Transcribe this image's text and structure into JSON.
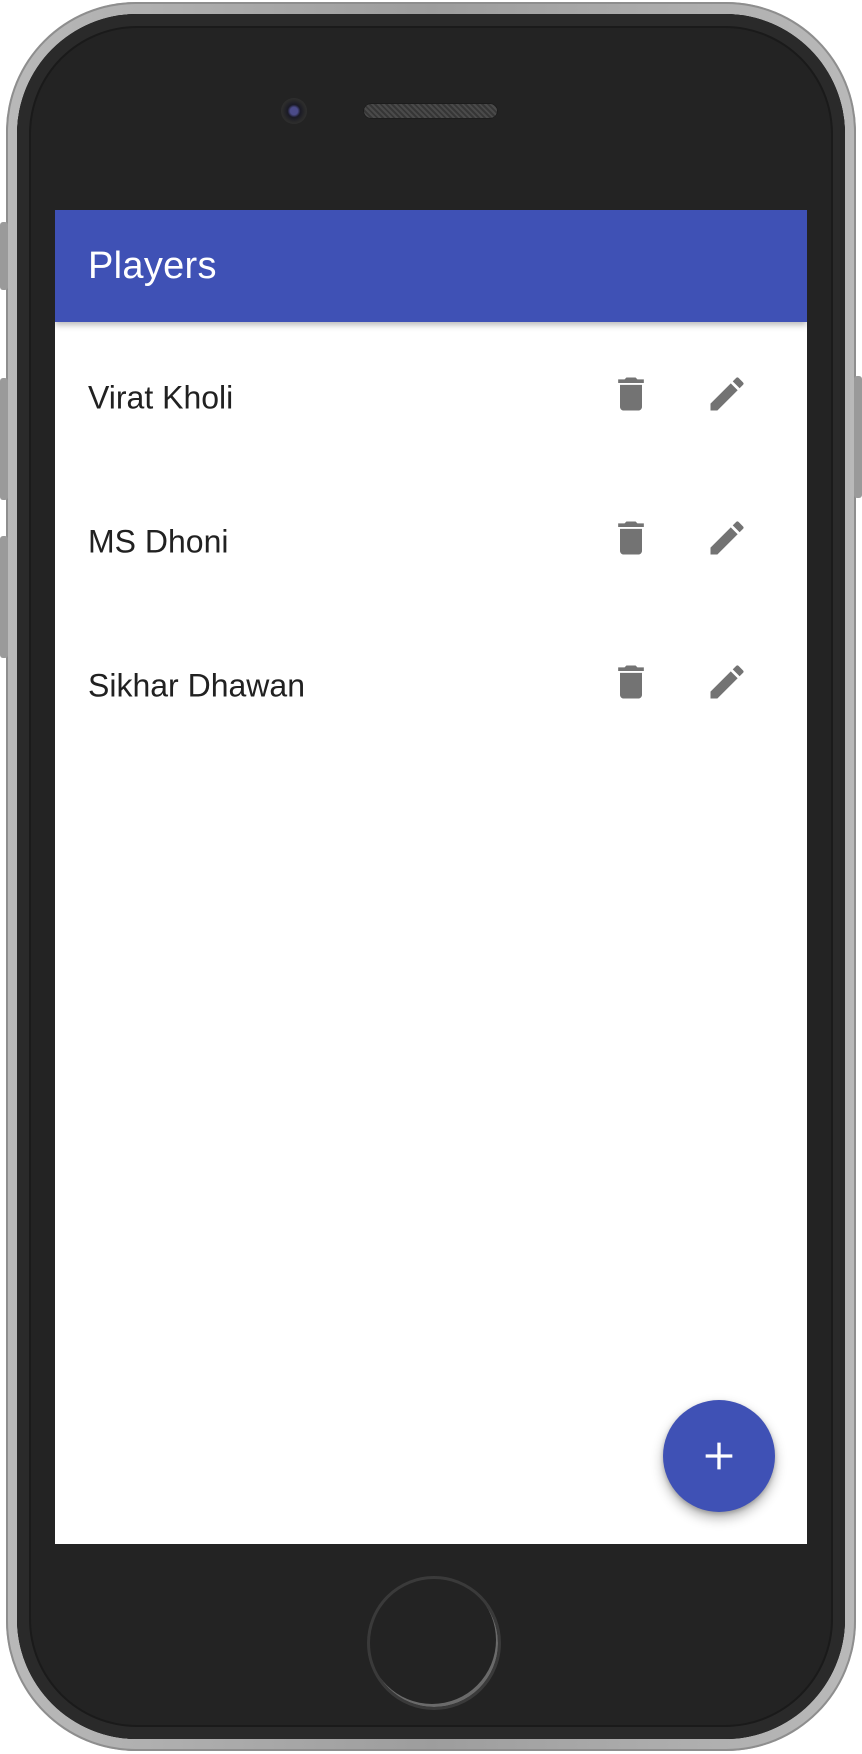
{
  "app": {
    "title": "Players"
  },
  "players": [
    {
      "name": "Virat Kholi"
    },
    {
      "name": "MS Dhoni"
    },
    {
      "name": "Sikhar Dhawan"
    }
  ],
  "icons": {
    "delete": "trash-icon",
    "edit": "pencil-icon",
    "add": "plus-icon"
  },
  "colors": {
    "primary": "#3f51b5",
    "icon": "#737373",
    "text": "#212121"
  }
}
